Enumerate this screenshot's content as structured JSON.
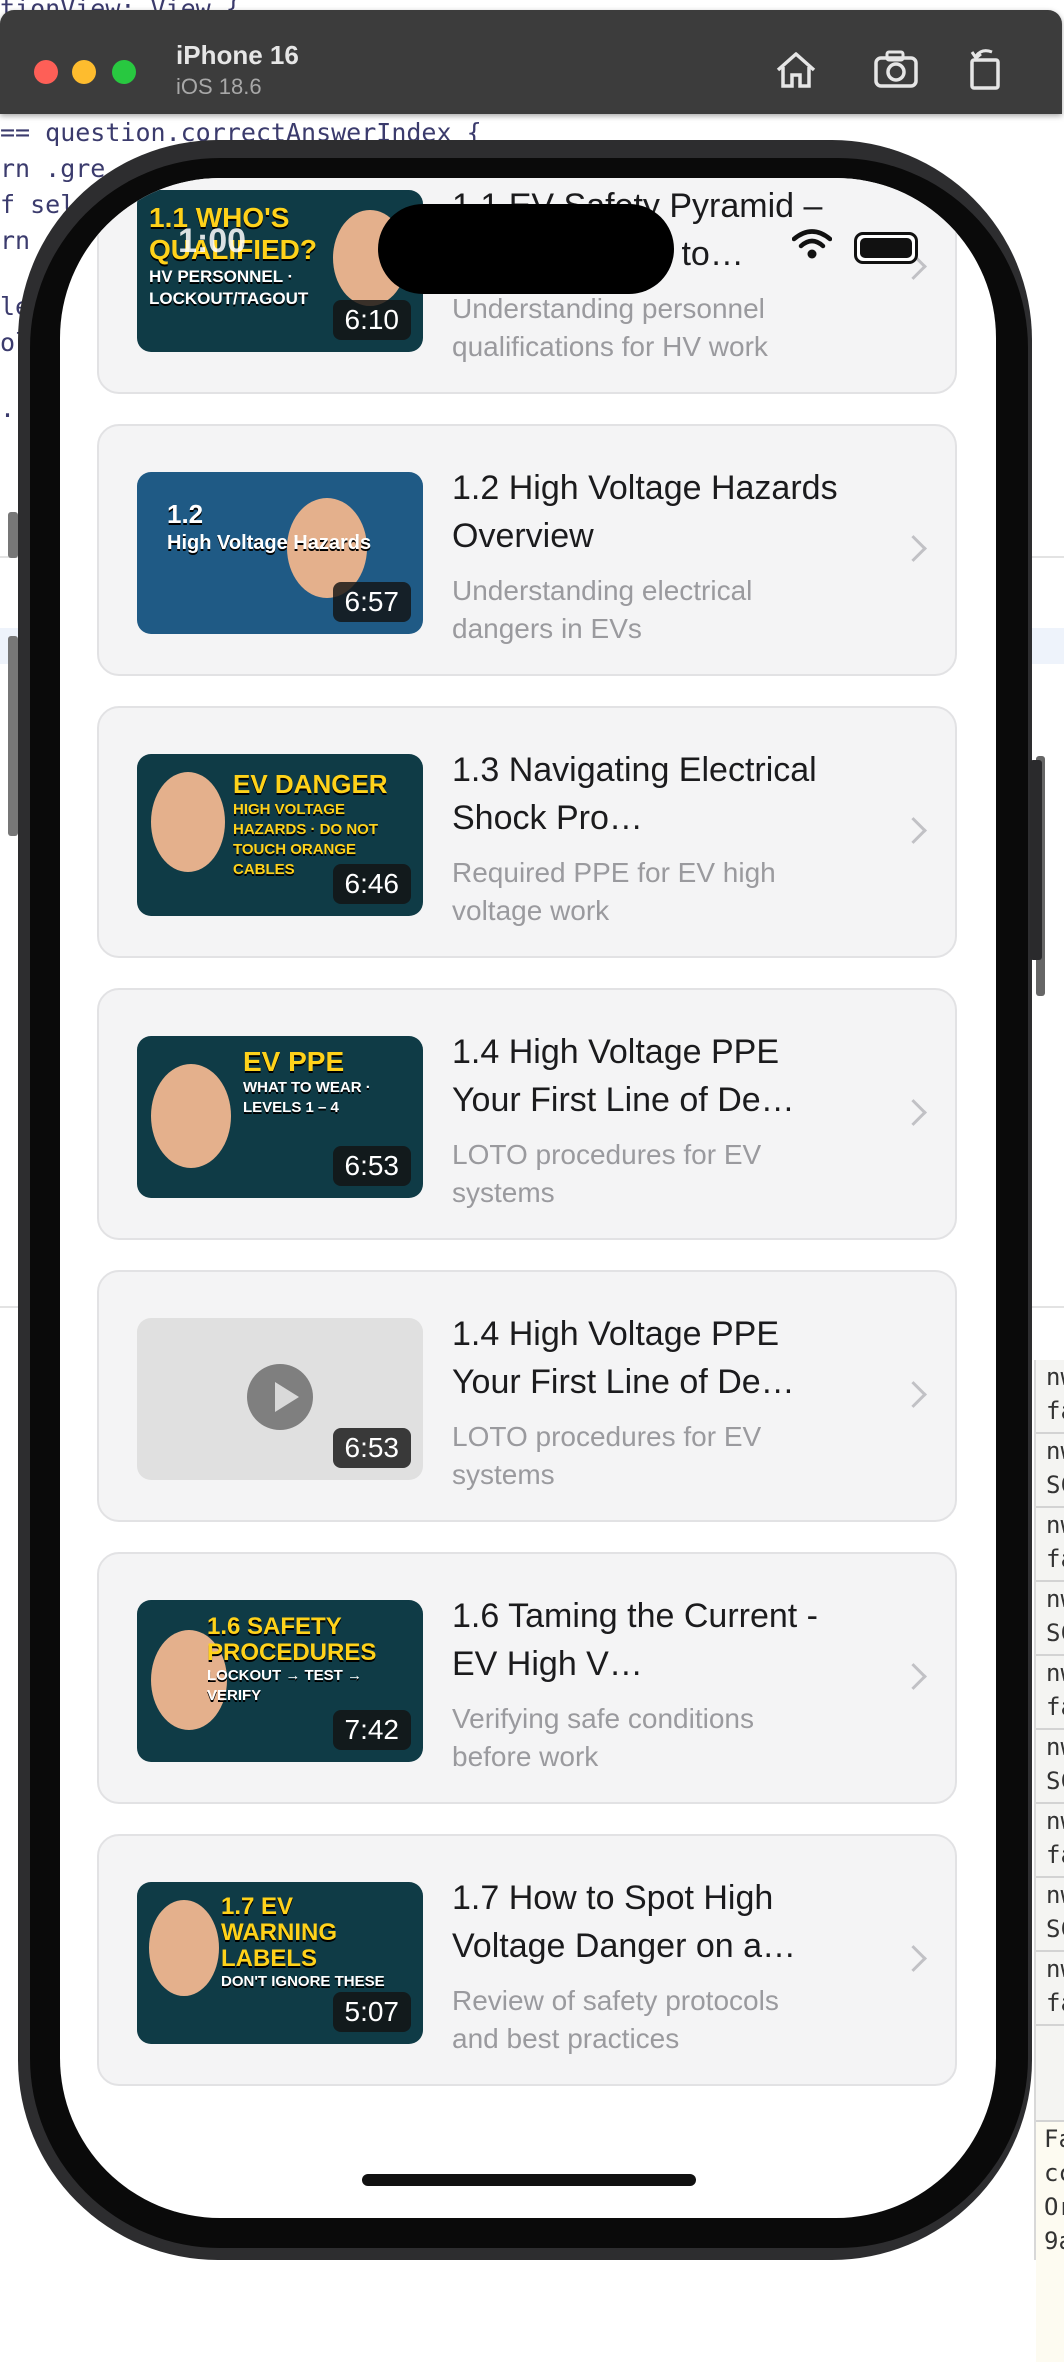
{
  "simulator": {
    "device_name": "iPhone 16",
    "os_version": "iOS 18.6",
    "home_icon": "home-icon",
    "screenshot_icon": "camera-icon",
    "rotate_icon": "rotate-icon"
  },
  "editor": {
    "code_lines": [
      "tionView: View {",
      "== question.correctAnswerIndex {",
      "rn .gre",
      "f sel",
      "rn",
      "le",
      "ol",
      "."
    ]
  },
  "console": {
    "rows": [
      "nw fa",
      "nw SC",
      "nw fa",
      "nw SC",
      "nw fa",
      "nw SC",
      "nw fa",
      "nw SC",
      "nw fa"
    ],
    "tail": [
      "Fa",
      "cc",
      "Or",
      "9a"
    ]
  },
  "status_bar": {
    "time": "1:00",
    "wifi_icon": "wifi-icon",
    "battery_icon": "battery-icon"
  },
  "lessons": [
    {
      "title": "1.1 EV Safety Pyramid – Who's Allowed to…",
      "subtitle": "Understanding personnel qualifications for HV work",
      "duration": "6:10",
      "thumb_text": "1.1 WHO'S QUALIFIED?",
      "thumb_sub": "HV PERSONNEL · LOCKOUT/TAGOUT"
    },
    {
      "title": "1.2 High Voltage Hazards Overview",
      "subtitle": "Understanding electrical dangers in EVs",
      "duration": "6:57",
      "thumb_text": "1.2",
      "thumb_sub": "High Voltage Hazards"
    },
    {
      "title": "1.3 Navigating Electrical Shock Pro…",
      "subtitle": "Required PPE for EV high voltage work",
      "duration": "6:46",
      "thumb_text": "EV DANGER",
      "thumb_sub": "HIGH VOLTAGE HAZARDS · DO NOT TOUCH ORANGE CABLES"
    },
    {
      "title": "1.4 High Voltage PPE Your First Line of De…",
      "subtitle": "LOTO procedures for EV systems",
      "duration": "6:53",
      "thumb_text": "EV PPE",
      "thumb_sub": "WHAT TO WEAR · LEVELS 1 – 4"
    },
    {
      "title": "1.4 High Voltage PPE Your First Line of De…",
      "subtitle": "LOTO procedures for EV systems",
      "duration": "6:53",
      "thumb_text": "",
      "thumb_sub": ""
    },
    {
      "title": "1.6 Taming the Current - EV High V…",
      "subtitle": "Verifying safe conditions before work",
      "duration": "7:42",
      "thumb_text": "1.6 SAFETY PROCEDURES",
      "thumb_sub": "LOCKOUT → TEST → VERIFY"
    },
    {
      "title": "1.7 How to Spot High Voltage Danger on a…",
      "subtitle": "Review of safety protocols and best practices",
      "duration": "5:07",
      "thumb_text": "1.7 EV WARNING LABELS",
      "thumb_sub": "DON'T IGNORE THESE"
    }
  ],
  "colors": {
    "thumb_bg_teal": "#0f3b46",
    "thumb_bg_blue": "#1f5a85",
    "thumb_text_yellow": "#ffd21a",
    "placeholder_bg": "#e0e0e0"
  }
}
